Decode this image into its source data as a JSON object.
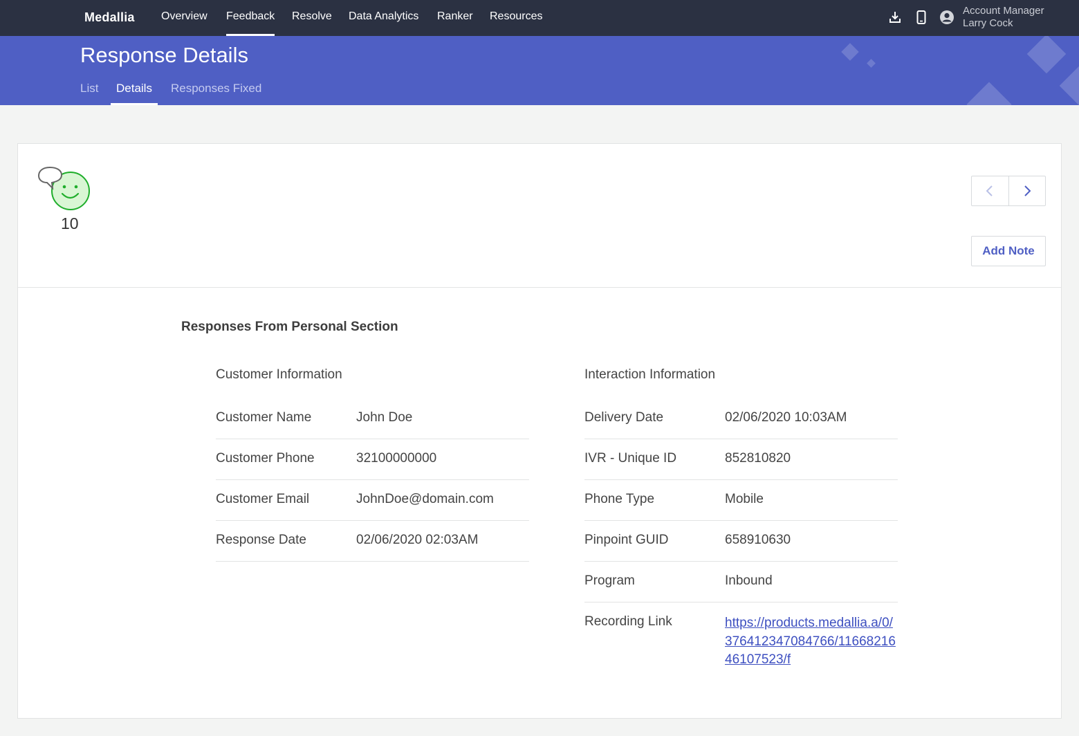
{
  "nav": {
    "logo": "Medallia",
    "items": [
      {
        "label": "Overview",
        "active": false
      },
      {
        "label": "Feedback",
        "active": true
      },
      {
        "label": "Resolve",
        "active": false
      },
      {
        "label": "Data Analytics",
        "active": false
      },
      {
        "label": "Ranker",
        "active": false
      },
      {
        "label": "Resources",
        "active": false
      }
    ],
    "icons": [
      "download-icon",
      "mobile-icon",
      "user-avatar-icon"
    ],
    "account_role": "Account Manager",
    "account_name": "Larry Cock"
  },
  "banner": {
    "title": "Response Details",
    "tabs": [
      {
        "label": "List",
        "active": false
      },
      {
        "label": "Details",
        "active": true
      },
      {
        "label": "Responses Fixed",
        "active": false
      }
    ]
  },
  "card": {
    "score": "10",
    "score_icon": "smiley-comment-icon",
    "add_note_label": "Add Note",
    "section_title": "Responses From Personal Section",
    "customer": {
      "heading": "Customer Information",
      "rows": [
        {
          "label": "Customer Name",
          "value": "John Doe"
        },
        {
          "label": "Customer Phone",
          "value": "32100000000"
        },
        {
          "label": "Customer Email",
          "value": "JohnDoe@domain.com"
        },
        {
          "label": "Response Date",
          "value": "02/06/2020 02:03AM"
        }
      ]
    },
    "interaction": {
      "heading": "Interaction Information",
      "rows": [
        {
          "label": "Delivery Date",
          "value": "02/06/2020 10:03AM"
        },
        {
          "label": "IVR - Unique ID",
          "value": "852810820"
        },
        {
          "label": "Phone Type",
          "value": "Mobile"
        },
        {
          "label": "Pinpoint GUID",
          "value": "658910630"
        },
        {
          "label": "Program",
          "value": "Inbound"
        }
      ],
      "recording_label": "Recording Link",
      "recording_link": "https://products.medallia.a/0/376412347084766/1166821646107523/f"
    }
  },
  "colors": {
    "topnav": "#2b3142",
    "banner": "#4f5fc4",
    "accent": "#3d4fc0",
    "smiley": "#1fae2b"
  }
}
